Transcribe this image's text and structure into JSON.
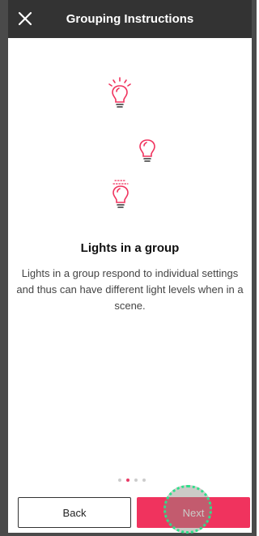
{
  "header": {
    "title": "Grouping Instructions",
    "close_icon": "close-icon"
  },
  "illustration": {
    "icons": [
      "lightbulb-on-icon",
      "lightbulb-icon",
      "lightbulb-dim-icon"
    ],
    "accent_color": "#f0335e"
  },
  "content": {
    "heading": "Lights in a group",
    "description": "Lights in a group respond to individual settings and thus can have different light levels when in a scene."
  },
  "pagination": {
    "total": 4,
    "current": 2
  },
  "footer": {
    "back_label": "Back",
    "next_label": "Next"
  }
}
